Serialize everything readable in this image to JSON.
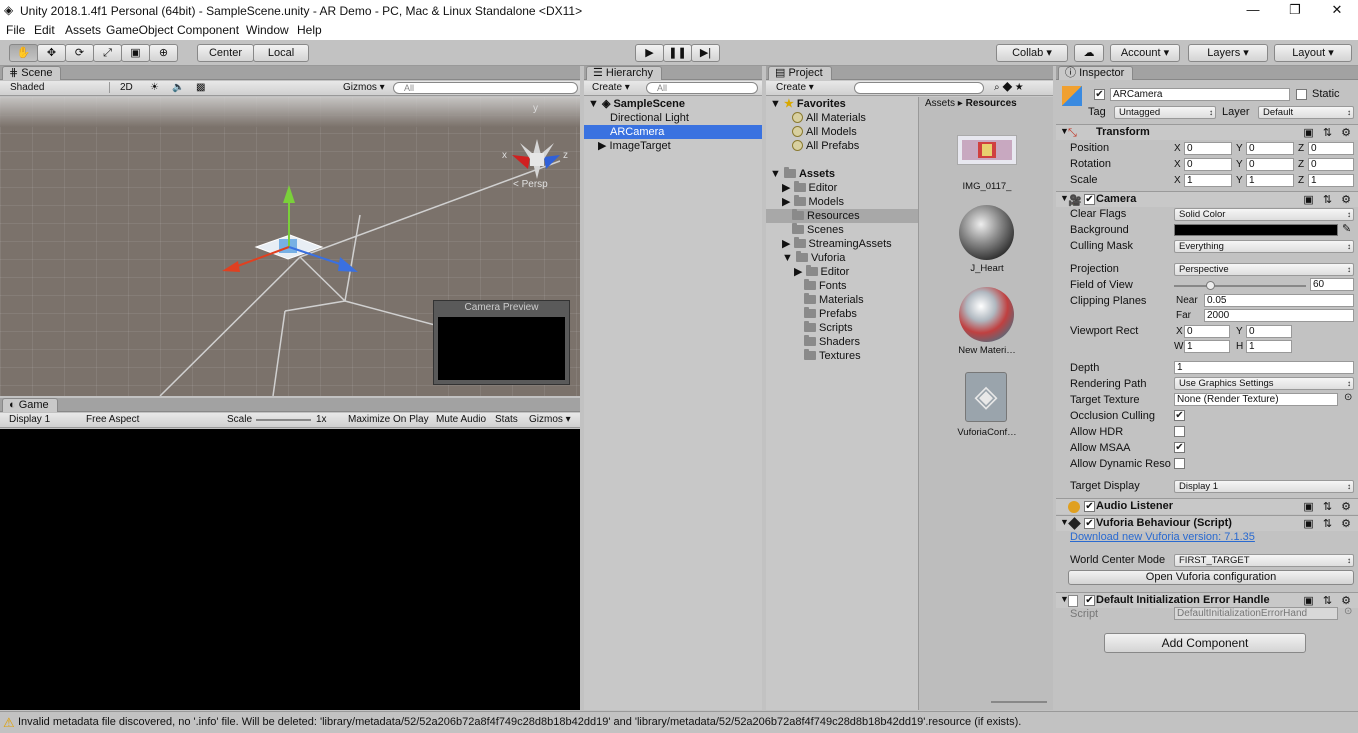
{
  "window": {
    "title": "Unity 2018.1.4f1 Personal (64bit) - SampleScene.unity - AR Demo - PC, Mac & Linux Standalone <DX11>",
    "minimize": "—",
    "maximize": "❐",
    "close": "✕"
  },
  "menu": [
    "File",
    "Edit",
    "Assets",
    "GameObject",
    "Component",
    "Window",
    "Help"
  ],
  "toolbar": {
    "tools": [
      "hand-tool",
      "move-tool",
      "rotate-tool",
      "scale-tool",
      "rect-tool",
      "transform-tool"
    ],
    "center": "Center",
    "local": "Local",
    "collab": "Collab ▾",
    "account": "Account ▾",
    "layers": "Layers ▾",
    "layout": "Layout ▾"
  },
  "scene": {
    "tab": "Scene",
    "shading": "Shaded",
    "mode2d": "2D",
    "gizmos": "Gizmos ▾",
    "search": "All",
    "persp": "< Persp",
    "axis_y": "y",
    "axis_x": "x",
    "axis_z": "z",
    "camera_preview": "Camera Preview"
  },
  "game": {
    "tab": "Game",
    "display": "Display 1",
    "aspect": "Free Aspect",
    "scale": "Scale",
    "scale_val": "1x",
    "maximize": "Maximize On Play",
    "mute": "Mute Audio",
    "stats": "Stats",
    "gizmos": "Gizmos ▾"
  },
  "hierarchy": {
    "tab": "Hierarchy",
    "create": "Create ▾",
    "search": "All",
    "scene": "SampleScene",
    "items": [
      "Directional Light",
      "ARCamera",
      "ImageTarget"
    ]
  },
  "project": {
    "tab": "Project",
    "create": "Create ▾",
    "favorites": "Favorites",
    "fav_items": [
      "All Materials",
      "All Models",
      "All Prefabs"
    ],
    "assets": "Assets",
    "folders": [
      "Editor",
      "Models",
      "Resources",
      "Scenes",
      "StreamingAssets",
      "Vuforia"
    ],
    "vuforia_sub": [
      "Editor",
      "Fonts",
      "Materials",
      "Prefabs",
      "Scripts",
      "Shaders",
      "Textures"
    ],
    "breadcrumb": [
      "Assets",
      "Resources"
    ],
    "files": [
      "IMG_0117_",
      "J_Heart",
      "New Materi…",
      "VuforiaConf…"
    ]
  },
  "inspector": {
    "tab": "Inspector",
    "object": "ARCamera",
    "static": "Static",
    "tag_label": "Tag",
    "tag": "Untagged",
    "layer_label": "Layer",
    "layer": "Default",
    "transform": {
      "title": "Transform",
      "position": [
        "0",
        "0",
        "0"
      ],
      "rotation": [
        "0",
        "0",
        "0"
      ],
      "scale": [
        "1",
        "1",
        "1"
      ],
      "pos_label": "Position",
      "rot_label": "Rotation",
      "scale_label": "Scale",
      "axes": [
        "X",
        "Y",
        "Z"
      ]
    },
    "camera": {
      "title": "Camera",
      "clear_flags_label": "Clear Flags",
      "clear_flags": "Solid Color",
      "background_label": "Background",
      "culling_label": "Culling Mask",
      "culling": "Everything",
      "projection_label": "Projection",
      "projection": "Perspective",
      "fov_label": "Field of View",
      "fov": "60",
      "fov_fraction": 0.27,
      "clip_label": "Clipping Planes",
      "near_label": "Near",
      "near": "0.05",
      "far_label": "Far",
      "far": "2000",
      "viewport_label": "Viewport Rect",
      "vx": "0",
      "vy": "0",
      "vw": "1",
      "vh": "1",
      "depth_label": "Depth",
      "depth": "1",
      "rpath_label": "Rendering Path",
      "rpath": "Use Graphics Settings",
      "target_tex_label": "Target Texture",
      "target_tex": "None (Render Texture)",
      "occlusion_label": "Occlusion Culling",
      "hdr_label": "Allow HDR",
      "msaa_label": "Allow MSAA",
      "dynres_label": "Allow Dynamic Reso",
      "target_display_label": "Target Display",
      "target_display": "Display 1",
      "X": "X",
      "Y": "Y",
      "W": "W",
      "H": "H"
    },
    "audio": {
      "title": "Audio Listener"
    },
    "vuforia": {
      "title": "Vuforia Behaviour (Script)",
      "link": "Download new Vuforia version: 7.1.35",
      "wcm_label": "World Center Mode",
      "wcm": "FIRST_TARGET",
      "open_btn": "Open Vuforia configuration"
    },
    "default_init": {
      "title": "Default Initialization Error Handle",
      "script_label": "Script",
      "script": "DefaultInitializationErrorHand"
    },
    "add_component": "Add Component"
  },
  "status": {
    "message": "Invalid metadata file discovered, no '.info' file. Will be deleted: 'library/metadata/52/52a206b72a8f4f749c28d8b18b42dd19' and 'library/metadata/52/52a206b72a8f4f749c28d8b18b42dd19'.resource (if exists)."
  }
}
